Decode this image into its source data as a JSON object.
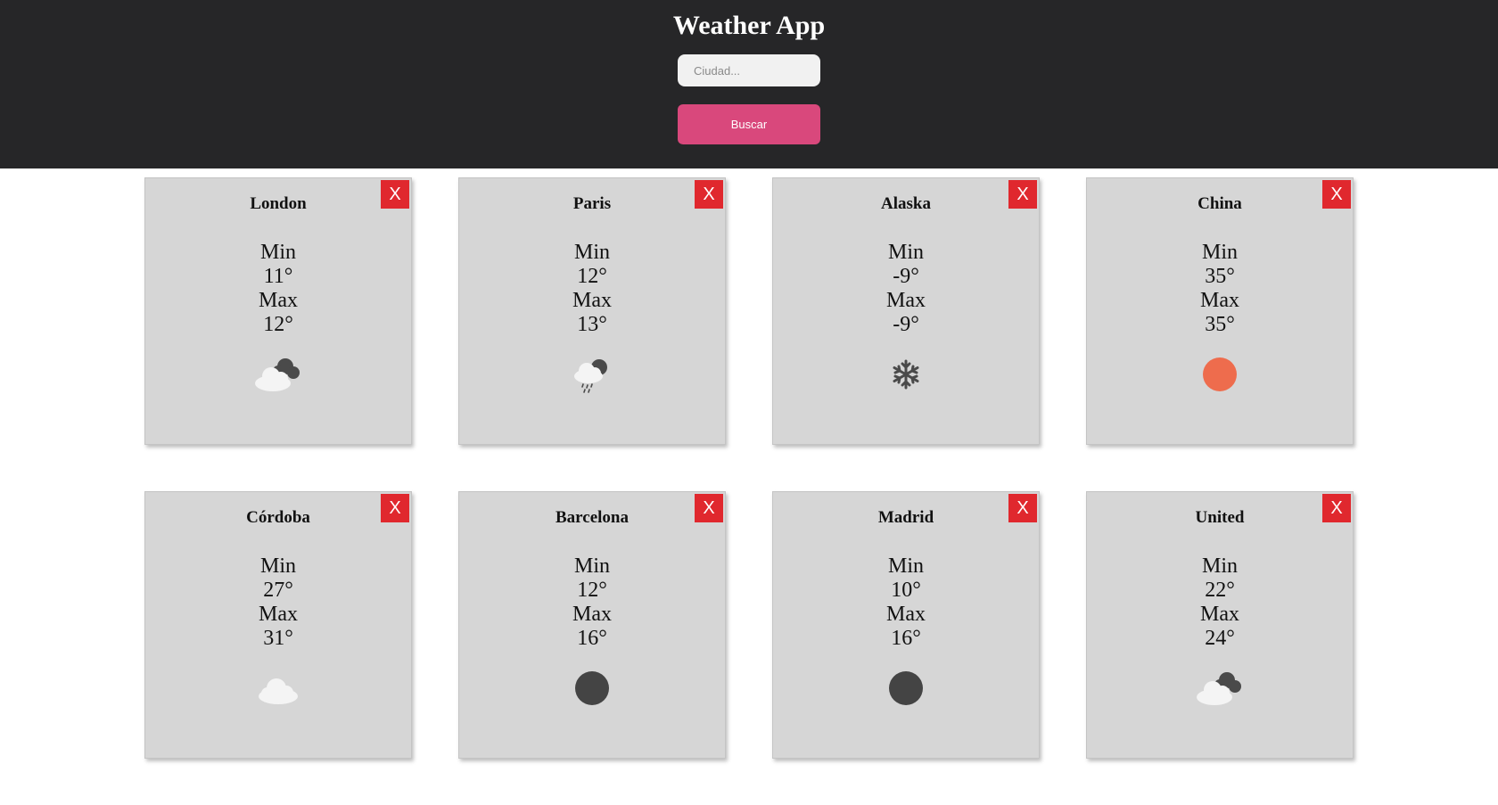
{
  "header": {
    "title": "Weather App",
    "search": {
      "value": "",
      "placeholder": "Ciudad..."
    },
    "search_button_label": "Buscar"
  },
  "colors": {
    "header_bg": "#262628",
    "accent": "#d9487c",
    "close_button": "#e0282e",
    "card_bg": "#d6d6d6"
  },
  "close_label": "X",
  "cards": [
    {
      "city": "London",
      "min_label": "Min",
      "min": "11°",
      "max_label": "Max",
      "max": "12°",
      "icon": "cloud-night-icon"
    },
    {
      "city": "Paris",
      "min_label": "Min",
      "min": "12°",
      "max_label": "Max",
      "max": "13°",
      "icon": "rain-night-icon"
    },
    {
      "city": "Alaska",
      "min_label": "Min",
      "min": "-9°",
      "max_label": "Max",
      "max": "-9°",
      "icon": "snowflake-icon"
    },
    {
      "city": "China",
      "min_label": "Min",
      "min": "35°",
      "max_label": "Max",
      "max": "35°",
      "icon": "sun-icon"
    },
    {
      "city": "Córdoba",
      "min_label": "Min",
      "min": "27°",
      "max_label": "Max",
      "max": "31°",
      "icon": "cloud-icon"
    },
    {
      "city": "Barcelona",
      "min_label": "Min",
      "min": "12°",
      "max_label": "Max",
      "max": "16°",
      "icon": "moon-icon"
    },
    {
      "city": "Madrid",
      "min_label": "Min",
      "min": "10°",
      "max_label": "Max",
      "max": "16°",
      "icon": "moon-icon"
    },
    {
      "city": "United",
      "min_label": "Min",
      "min": "22°",
      "max_label": "Max",
      "max": "24°",
      "icon": "cloud-night-icon"
    }
  ]
}
